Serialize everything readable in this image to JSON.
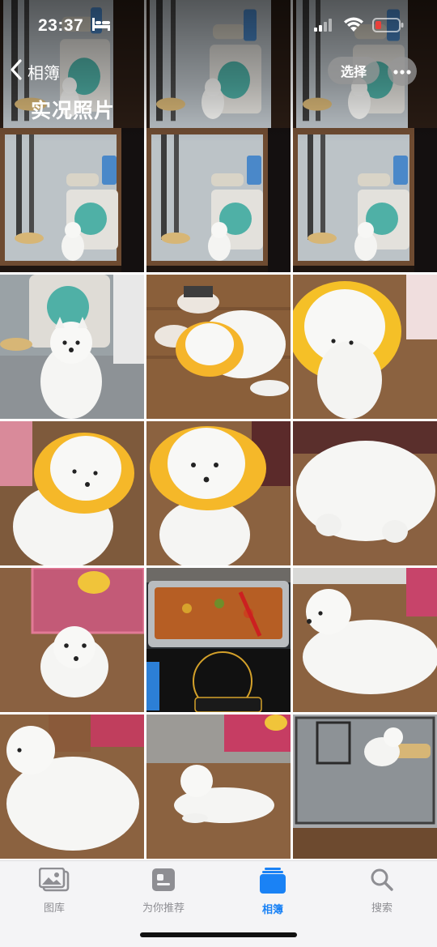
{
  "status_bar": {
    "time": "23:37"
  },
  "nav": {
    "back_label": "相簿",
    "album_title": "实况照片",
    "select_label": "选择"
  },
  "photos": [
    {
      "type": "window",
      "desc": "dog at glass door with washing machine"
    },
    {
      "type": "window",
      "desc": "dog at glass door with washing machine"
    },
    {
      "type": "window",
      "desc": "dog at glass door with washing machine"
    },
    {
      "type": "window",
      "desc": "dog at glass door with washing machine"
    },
    {
      "type": "window",
      "desc": "dog at glass door with washing machine"
    },
    {
      "type": "window",
      "desc": "dog at glass door with washing machine"
    },
    {
      "type": "puppy-room",
      "desc": "white puppy in front of washing machine"
    },
    {
      "type": "cone-slippers",
      "desc": "puppy with yellow cone near slippers"
    },
    {
      "type": "cone-top",
      "desc": "puppy with yellow flower cone from above"
    },
    {
      "type": "cone-side",
      "desc": "puppy with yellow cone sitting"
    },
    {
      "type": "cone-front",
      "desc": "puppy with yellow cone front view"
    },
    {
      "type": "fluffy",
      "desc": "fluffy white puppy close up"
    },
    {
      "type": "puppy-cage",
      "desc": "puppy sitting near pink cage"
    },
    {
      "type": "food-tray",
      "desc": "food tray on induction cooker"
    },
    {
      "type": "lying",
      "desc": "white puppy lying on floor"
    },
    {
      "type": "sitting-left",
      "desc": "puppy sitting looking left"
    },
    {
      "type": "lying-far",
      "desc": "puppy lying on floor far view"
    },
    {
      "type": "balcony",
      "desc": "puppy on balcony behind glass door"
    }
  ],
  "tabs": [
    {
      "label": "图库",
      "icon": "photo-library-icon"
    },
    {
      "label": "为你推荐",
      "icon": "for-you-icon"
    },
    {
      "label": "相簿",
      "icon": "albums-icon",
      "active": true
    },
    {
      "label": "搜索",
      "icon": "search-icon"
    }
  ],
  "colors": {
    "accent": "#1a82f5",
    "tab_inactive": "#8e8e93"
  }
}
